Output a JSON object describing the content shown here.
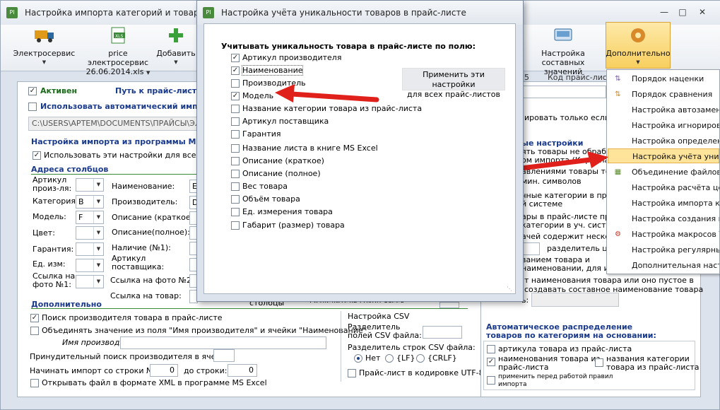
{
  "main_window": {
    "title": "Настройка импорта категорий и товаров из",
    "toolbar": [
      {
        "label": "Электросервис",
        "has_dropdown": true
      },
      {
        "label": "price электросервис 26.06.2014.xls",
        "line1": "price электросервис",
        "line2": "26.06.2014.xls",
        "has_dropdown": true
      },
      {
        "label": "Добавить",
        "has_dropdown": true
      },
      {
        "label": "Настройка составных значений",
        "line1": "Настройка составных",
        "line2": "значений"
      },
      {
        "label": "Дополнительно",
        "has_dropdown": true
      }
    ],
    "active_label": "Активен",
    "path_label": "Путь к прайс-листу:",
    "auto_import_label": "Использовать автоматический импорт",
    "path_value": "C:\\USERS\\АРТЕМ\\DOCUMENTS\\ПРАЙСЫ\\ЭЛЕКТ",
    "ms_section_title": "Настройка импорта из программы Micro",
    "use_for_all_label": "Использовать эти настройки для всех лис",
    "columns_title": "Адреса столбцов",
    "columns_left": [
      {
        "label": "Артикул произ-ля:",
        "line1": "Артикул",
        "line2": "произ-ля:",
        "value": ""
      },
      {
        "label": "Категория:",
        "value": "B"
      },
      {
        "label": "Модель:",
        "value": "F"
      },
      {
        "label": "Цвет:",
        "value": ""
      },
      {
        "label": "Гарантия:",
        "value": ""
      },
      {
        "label": "Ед. изм:",
        "value": ""
      },
      {
        "label": "Ссылка на фото №1:",
        "line1": "Ссылка на",
        "line2": "фото №1:",
        "value": ""
      }
    ],
    "columns_mid": [
      {
        "label": "Наименование:",
        "value": "E"
      },
      {
        "label": "Производитель:",
        "value": "D"
      },
      {
        "label": "Описание (краткое):",
        "value": ""
      },
      {
        "label": "Описание(полное):",
        "value": ""
      },
      {
        "label": "Наличие (№1):",
        "value": ""
      },
      {
        "label": "Артикул поставщика:",
        "line1": "Артикул",
        "line2": "поставщика:",
        "value": ""
      },
      {
        "label": "Ссылка на фото №2:",
        "value": ""
      },
      {
        "label": "Ссылка на товар:",
        "value": ""
      }
    ],
    "partial_text": {
      "stolbcy": "столбцы",
      "razdelitel_grupp": "Разделитель групп ячеек"
    },
    "extra_title": "Дополнительно",
    "search_manufacturer_label": "Поиск производителя товара в прайс-листе",
    "combine_label": "Объединять значение из поля \"Имя производителя\" и ячейки \"Наименование\"",
    "manufacturer_name_label": "Имя производителя:",
    "forced_search_label": "Принудительный поиск производителя в ячейке:",
    "start_row_label": "Начинать импорт со строки №:",
    "start_row_value": "0",
    "to_row_label": "до строки:",
    "to_row_value": "0",
    "open_xml_label": "Открывать файл в формате XML в программе MS Excel",
    "csv_title": "Настройка CSV",
    "csv_field_sep_label": "Разделитель полей CSV файла:",
    "csv_field_sep_line1": "Разделитель",
    "csv_field_sep_line2": "полей CSV файла:",
    "csv_row_sep_label": "Разделитель строк CSV файла:",
    "csv_row_sep_options": [
      "Нет",
      "{LF}",
      "{CRLF}"
    ],
    "csv_row_sep_selected": "Нет",
    "utf8_label": "Прайс-лист в кодировке UTF-8",
    "right_panel": {
      "col_header_fragment": "5",
      "col_header": "Код прайс-листа",
      "lines": [
        "ировать только если и",
        "ые настройки",
        "ять товары не обрабо",
        "ом импорта (Корзина",
        "авлениями товары тольк",
        "мин. символов",
        "чные категории в прай",
        "й системе",
        "ары в прайс-листе при",
        "категории в уч. систем",
        "ачей содержит несколь",
        "разделитель цен",
        "ванием товара и",
        "наименовании, для им",
        "т наименования товара или оно пустое в",
        "создавать составное наименование товара",
        "ь:"
      ],
      "auto_dist_title": "Автоматическое распределение товаров по категориям на основании:",
      "auto_dist_line1": "Автоматическое распределение",
      "auto_dist_line2": "товаров по категориям на основании:",
      "by_article": "артикула товара из прайс-листа",
      "by_name": "наименования товара из прайс-листа",
      "by_name_line1": "наименования товара из",
      "by_name_line2": "прайс-листа",
      "by_category": "названия категории товара из прайс-листа",
      "by_category_line1": "названия категории",
      "by_category_line2": "товара из прайс-листа",
      "apply_before": "применить перед работой правил импорта",
      "apply_before_line1": "применить перед работой правил",
      "apply_before_line2": "импорта"
    }
  },
  "menu": {
    "items": [
      {
        "label": "Порядок наценки",
        "icon": "markup-order-icon"
      },
      {
        "label": "Порядок сравнения",
        "icon": "compare-order-icon"
      },
      {
        "label": "Настройка автозамены",
        "icon": "none"
      },
      {
        "label": "Настройка игнорирова",
        "icon": "none"
      },
      {
        "label": "Настройка определени",
        "icon": "none"
      },
      {
        "label": "Настройка учёта уника",
        "icon": "none",
        "highlighted": true
      },
      {
        "label": "Объединение файлов",
        "icon": "merge-files-icon"
      },
      {
        "label": "Настройка расчёта цен",
        "icon": "none"
      },
      {
        "label": "Настройка импорта кро",
        "icon": "none"
      },
      {
        "label": "Настройка создания не",
        "icon": "none"
      },
      {
        "label": "Настройка макросов VB",
        "icon": "macro-icon"
      },
      {
        "label": "Настройка регулярных",
        "icon": "none"
      },
      {
        "label": "Дополнительная настр",
        "icon": "none"
      }
    ]
  },
  "dialog": {
    "title": "Настройка учёта уникальности товаров в прайс-листе",
    "heading": "Учитывать уникальность товара в прайс-листе по полю:",
    "apply_button": "Применить эти настройки для всех прайс-листов",
    "apply_line1": "Применить эти настройки",
    "apply_line2": "для всех прайс-листов",
    "fields": [
      {
        "label": "Артикул производителя",
        "checked": true
      },
      {
        "label": "Наименование",
        "checked": true,
        "focused": true
      },
      {
        "label": "Производитель",
        "checked": false
      },
      {
        "label": "Модель",
        "checked": true
      },
      {
        "label": "Название категории товара из прайс-листа",
        "checked": false
      },
      {
        "label": "Артикул поставщика",
        "checked": false
      },
      {
        "label": "Гарантия",
        "checked": false
      },
      {
        "label": "Название листа в книге MS Excel",
        "checked": false
      },
      {
        "label": "Описание (краткое)",
        "checked": false
      },
      {
        "label": "Описание (полное)",
        "checked": false
      },
      {
        "label": "Вес товара",
        "checked": false
      },
      {
        "label": "Объём товара",
        "checked": false
      },
      {
        "label": "Ед. измерения товара",
        "checked": false
      },
      {
        "label": "Габарит (размер) товара",
        "checked": false
      }
    ]
  },
  "colors": {
    "accent": "#1a3a8c",
    "section_line": "#3a8a3a",
    "menu_highlight": "#fde49a",
    "arrow": "#e0201a"
  }
}
